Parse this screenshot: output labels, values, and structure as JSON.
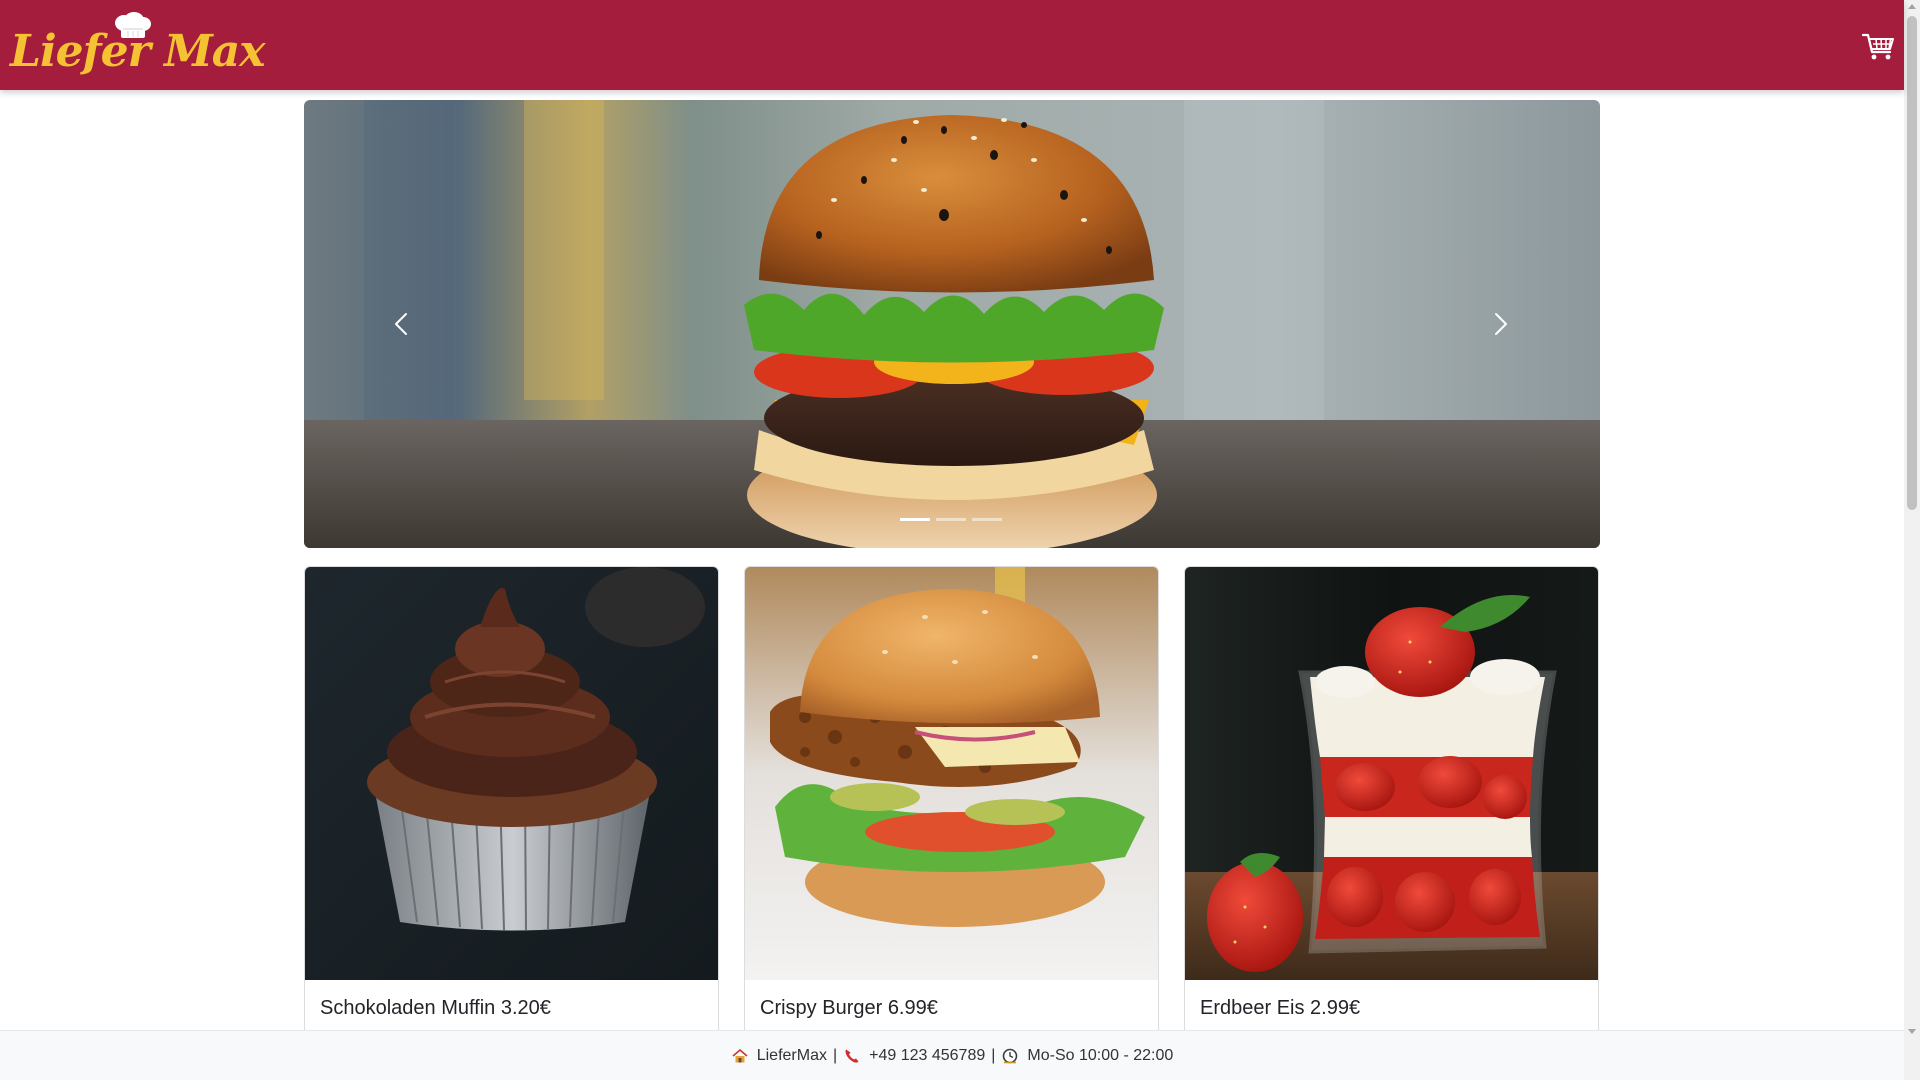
{
  "header": {
    "logo_text": "Liefer Max",
    "cart_icon": "shopping-cart-icon"
  },
  "carousel": {
    "slide_count": 3,
    "active_index": 0,
    "prev_icon": "chevron-left-icon",
    "next_icon": "chevron-right-icon"
  },
  "cards": [
    {
      "title": "Schokoladen Muffin 3.20€"
    },
    {
      "title": "Crispy Burger 6.99€"
    },
    {
      "title": "Erdbeer Eis 2.99€"
    }
  ],
  "footer": {
    "name": "LieferMax",
    "separator": "|",
    "phone": "+49 123 456789",
    "hours": "Mo-So 10:00 - 22:00",
    "icons": [
      "home-icon",
      "phone-icon",
      "clock-icon"
    ]
  },
  "colors": {
    "brand": "#a51d3c",
    "logo": "#f4c233",
    "footer_bg": "#f8f9fa"
  }
}
